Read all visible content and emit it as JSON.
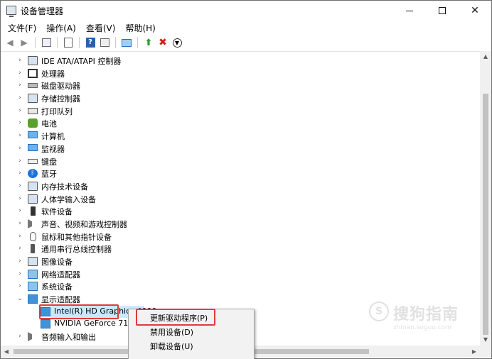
{
  "window": {
    "title": "设备管理器"
  },
  "menu": [
    "文件(F)",
    "操作(A)",
    "查看(V)",
    "帮助(H)"
  ],
  "toolbar": [
    "back-arrow-icon",
    "forward-arrow-icon",
    "properties-icon",
    "view-icon",
    "help-icon",
    "list-icon",
    "monitor-scan-icon",
    "add-driver-icon",
    "remove-icon",
    "download-icon"
  ],
  "tree": {
    "items": [
      {
        "label": "IDE ATA/ATAPI 控制器",
        "icon": "ide-controller-icon"
      },
      {
        "label": "处理器",
        "icon": "processor-icon"
      },
      {
        "label": "磁盘驱动器",
        "icon": "disk-drive-icon"
      },
      {
        "label": "存储控制器",
        "icon": "storage-controller-icon"
      },
      {
        "label": "打印队列",
        "icon": "printer-icon"
      },
      {
        "label": "电池",
        "icon": "battery-icon"
      },
      {
        "label": "计算机",
        "icon": "computer-icon"
      },
      {
        "label": "监视器",
        "icon": "monitor-icon"
      },
      {
        "label": "键盘",
        "icon": "keyboard-icon"
      },
      {
        "label": "蓝牙",
        "icon": "bluetooth-icon"
      },
      {
        "label": "内存技术设备",
        "icon": "memory-device-icon"
      },
      {
        "label": "人体学输入设备",
        "icon": "hid-icon"
      },
      {
        "label": "软件设备",
        "icon": "software-device-icon"
      },
      {
        "label": "声音、视频和游戏控制器",
        "icon": "sound-icon"
      },
      {
        "label": "鼠标和其他指针设备",
        "icon": "mouse-icon"
      },
      {
        "label": "通用串行总线控制器",
        "icon": "usb-icon"
      },
      {
        "label": "图像设备",
        "icon": "camera-icon"
      },
      {
        "label": "网络适配器",
        "icon": "network-icon"
      },
      {
        "label": "系统设备",
        "icon": "system-device-icon"
      },
      {
        "label": "显示适配器",
        "icon": "display-adapter-icon",
        "expanded": true
      }
    ],
    "children": [
      {
        "label": "Intel(R) HD Graphics 4000"
      },
      {
        "label": "NVIDIA GeForce 710M"
      }
    ],
    "after": {
      "label": "音频输入和输出",
      "icon": "audio-io-icon"
    }
  },
  "context_menu": [
    "更新驱动程序(P)",
    "禁用设备(D)",
    "卸载设备(U)"
  ],
  "watermark": {
    "brand": "搜狗指南",
    "url": "zhinan.sogou.com"
  }
}
